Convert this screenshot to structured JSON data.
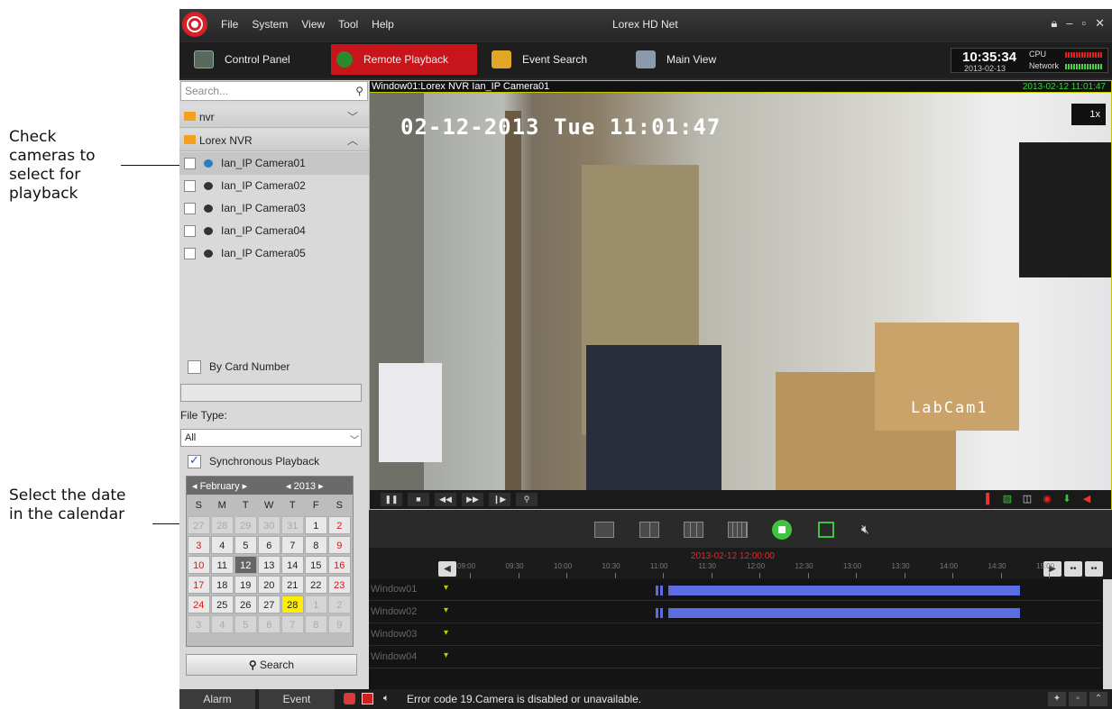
{
  "annotations": {
    "check_cameras": "Check\ncameras to\nselect for\nplayback",
    "select_date": "Select the date\nin the calendar"
  },
  "titlebar": {
    "app_title": "Lorex HD Net",
    "menu": [
      "File",
      "System",
      "View",
      "Tool",
      "Help"
    ]
  },
  "toolbar": {
    "tabs": [
      {
        "label": "Control Panel",
        "icon": "control-panel-icon"
      },
      {
        "label": "Remote Playback",
        "icon": "playback-icon",
        "active": true
      },
      {
        "label": "Event Search",
        "icon": "folder-search-icon"
      },
      {
        "label": "Main View",
        "icon": "monitor-icon"
      }
    ],
    "clock_time": "10:35:34",
    "clock_date": "2013-02-13",
    "cpu_label": "CPU",
    "network_label": "Network"
  },
  "sidebar": {
    "search_placeholder": "Search...",
    "groups": [
      {
        "label": "nvr",
        "expanded": false
      },
      {
        "label": "Lorex NVR",
        "expanded": true
      }
    ],
    "cameras": [
      "Ian_IP Camera01",
      "Ian_IP Camera02",
      "Ian_IP Camera03",
      "Ian_IP Camera04",
      "Ian_IP Camera05"
    ],
    "by_card_number": "By Card Number",
    "file_type_label": "File Type:",
    "file_type_value": "All",
    "sync_playback": "Synchronous Playback",
    "search_button": "Search",
    "calendar": {
      "month": "February",
      "year": "2013",
      "dow": [
        "S",
        "M",
        "T",
        "W",
        "T",
        "F",
        "S"
      ],
      "weeks": [
        [
          "27",
          "28",
          "29",
          "30",
          "31",
          "1",
          "2"
        ],
        [
          "3",
          "4",
          "5",
          "6",
          "7",
          "8",
          "9"
        ],
        [
          "10",
          "11",
          "12",
          "13",
          "14",
          "15",
          "16"
        ],
        [
          "17",
          "18",
          "19",
          "20",
          "21",
          "22",
          "23"
        ],
        [
          "24",
          "25",
          "26",
          "27",
          "28",
          "1",
          "2"
        ],
        [
          "3",
          "4",
          "5",
          "6",
          "7",
          "8",
          "9"
        ]
      ],
      "selected": "12",
      "today": "28"
    }
  },
  "video": {
    "window_label": "Window01:Lorex NVR Ian_IP Camera01",
    "window_timestamp": "2013-02-12 11:01:47",
    "osd_datetime": "02-12-2013 Tue 11:01:47",
    "speed": "1x",
    "camera_overlay": "LabCam1"
  },
  "timeline": {
    "cursor_time": "2013-02-12 12:00:00",
    "ticks": [
      "09:00",
      "09:30",
      "10:00",
      "10:30",
      "11:00",
      "11:30",
      "12:00",
      "12:30",
      "13:00",
      "13:30",
      "14:00",
      "14:30",
      "15:00"
    ],
    "rows": [
      "Window01",
      "Window02",
      "Window03",
      "Window04"
    ]
  },
  "statusbar": {
    "tabs": [
      "Alarm",
      "Event"
    ],
    "message": "Error code 19.Camera is disabled or unavailable."
  },
  "colors": {
    "accent": "#c8141b",
    "record_bar": "#5b6de0",
    "timestamp_green": "#36d636",
    "highlight_border": "#c8c800"
  }
}
